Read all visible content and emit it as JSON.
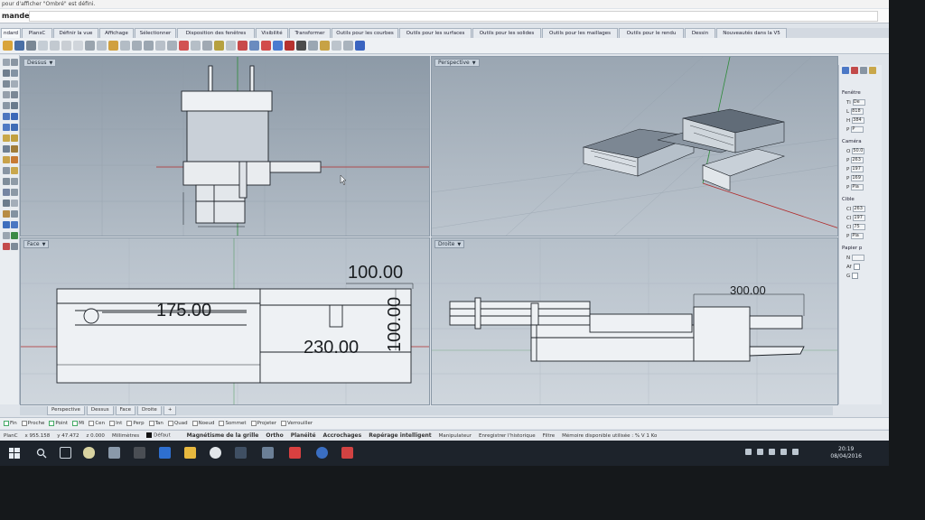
{
  "command": {
    "history_text": "pour d'afficher \"Ombré\" est défini.",
    "prompt_label": "mande:"
  },
  "tabs": [
    {
      "label": "ndard"
    },
    {
      "label": "PlansC"
    },
    {
      "label": "Définir la vue"
    },
    {
      "label": "Affichage"
    },
    {
      "label": "Sélectionner"
    },
    {
      "label": "Disposition des fenêtres"
    },
    {
      "label": "Visibilité"
    },
    {
      "label": "Transformer"
    },
    {
      "label": "Outils pour les courbes"
    },
    {
      "label": "Outils pour les surfaces"
    },
    {
      "label": "Outils pour les solides"
    },
    {
      "label": "Outils pour les maillages"
    },
    {
      "label": "Outils pour le rendu"
    },
    {
      "label": "Dessin"
    },
    {
      "label": "Nouveautés dans la V5"
    }
  ],
  "viewports": {
    "top": {
      "label": "Dessus"
    },
    "perspective": {
      "label": "Perspective"
    },
    "front": {
      "label": "Face"
    },
    "right": {
      "label": "Droite"
    }
  },
  "dimensions": {
    "front_width": "175.00",
    "front_total": "230.00",
    "front_height_top": "100.00",
    "front_vertical": "100.00",
    "right_width": "300.00"
  },
  "viewport_tabs": [
    {
      "label": "Perspective"
    },
    {
      "label": "Dessus"
    },
    {
      "label": "Face"
    },
    {
      "label": "Droite"
    },
    {
      "label": "+"
    }
  ],
  "osnaps": [
    {
      "label": "Fin",
      "checked": true
    },
    {
      "label": "Proche",
      "checked": false
    },
    {
      "label": "Point",
      "checked": true
    },
    {
      "label": "Mi",
      "checked": true
    },
    {
      "label": "Cen",
      "checked": false
    },
    {
      "label": "Int",
      "checked": false
    },
    {
      "label": "Perp",
      "checked": false
    },
    {
      "label": "Tan",
      "checked": false
    },
    {
      "label": "Quad",
      "checked": false
    },
    {
      "label": "Noeud",
      "checked": false
    },
    {
      "label": "Sommet",
      "checked": false
    },
    {
      "label": "Projeter",
      "checked": false
    },
    {
      "label": "Verrouiller",
      "checked": false
    }
  ],
  "status": {
    "plane": "PlanC",
    "x": "x 955.158",
    "y": "y 47.472",
    "z": "z 0.000",
    "units": "Millimètres",
    "layer": "Défaut",
    "grid_snap": "Magnétisme de la grille",
    "ortho": "Ortho",
    "planar": "Planéité",
    "osnap": "Accrochages",
    "smart_track": "Repérage intelligent",
    "gumball": "Manipulateur",
    "record_history": "Enregistrer l'historique",
    "filter": "Filtre",
    "memory": "Mémoire disponible utilisée : % V 1 Ko"
  },
  "properties": {
    "viewport_section": "Fenêtre",
    "title_field": "Ti",
    "title_value": "De",
    "width_field": "L",
    "width_value": "818",
    "height_field": "H",
    "height_value": "384",
    "proj_field": "P",
    "proj_value": "P",
    "camera_section": "Caméra",
    "lens_field": "O",
    "lens_value": "50.0",
    "cam_p1_field": "P",
    "cam_p1_value": "263",
    "cam_p2_field": "P",
    "cam_p2_value": "197",
    "cam_p3_field": "P",
    "cam_p3_value": "169",
    "cam_p4_field": "P",
    "cam_p4_value": "Pla",
    "target_section": "Cible",
    "t1_field": "Cl",
    "t1_value": "263",
    "t2_field": "Cl",
    "t2_value": "197",
    "t3_field": "Cl",
    "t3_value": "75",
    "t4_field": "P",
    "t4_value": "Pla",
    "paper_section": "Papier p",
    "paper_n": "N",
    "paper_a": "Af",
    "paper_g": "G"
  },
  "clock": {
    "time": "20:19",
    "date": "08/04/2016"
  },
  "colors": {
    "ui_bg": "#dfe4ea",
    "viewport_grid": "#8e9aa6",
    "x_axis": "#b02a2a",
    "y_axis": "#2e8b3a",
    "taskbar": "#1d232b"
  }
}
